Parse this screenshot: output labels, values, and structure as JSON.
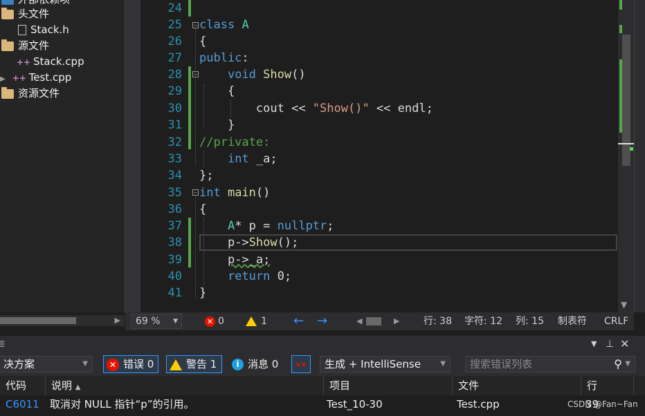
{
  "solution_explorer": {
    "items": [
      {
        "label": "外部依赖项",
        "icon": "external-deps-icon"
      },
      {
        "label": "头文件",
        "icon": "folder-icon"
      },
      {
        "label": "Stack.h",
        "icon": "header-file-icon"
      },
      {
        "label": "源文件",
        "icon": "folder-icon"
      },
      {
        "label": "Stack.cpp",
        "icon": "cpp-file-icon"
      },
      {
        "label": "Test.cpp",
        "icon": "cpp-file-icon"
      },
      {
        "label": "资源文件",
        "icon": "folder-icon"
      }
    ]
  },
  "editor": {
    "line_numbers": [
      "24",
      "25",
      "26",
      "27",
      "28",
      "29",
      "30",
      "31",
      "32",
      "33",
      "34",
      "35",
      "36",
      "37",
      "38",
      "39",
      "40",
      "41"
    ],
    "code": {
      "l25_kw": "class",
      "l25_name": "A",
      "l26": "{",
      "l27_kw": "public",
      "l27_colon": ":",
      "l28_kw": "void",
      "l28_fn": "Show",
      "l28_paren": "()",
      "l29": "{",
      "l30_cout": "cout",
      "l30_op1": " << ",
      "l30_str": "\"Show()\"",
      "l30_op2": " << ",
      "l30_endl": "endl",
      "l30_semi": ";",
      "l31": "}",
      "l32_comment": "//private:",
      "l33_kw": "int",
      "l33_var": " _a;",
      "l34": "};",
      "l35_kw": "int",
      "l35_fn": " main",
      "l35_paren": "()",
      "l36": "{",
      "l37_type": "A",
      "l37_rest": "* p = ",
      "l37_kw": "nullptr",
      "l37_semi": ";",
      "l38_var": "p->",
      "l38_fn": "Show",
      "l38_rest": "();",
      "l39": "p->_a;",
      "l40_kw": "return",
      "l40_rest": " 0;",
      "l41": "}"
    }
  },
  "status_bar": {
    "zoom": "69 %",
    "errors": "0",
    "warnings": "1",
    "line": "行: 38",
    "char": "字符: 12",
    "col": "列: 15",
    "tabs": "制表符",
    "eol": "CRLF"
  },
  "error_list": {
    "scope": "决方案",
    "errors_btn": "错误 0",
    "warnings_btn": "警告 1",
    "messages_btn": "消息 0",
    "build_filter": "生成 + IntelliSense",
    "search_placeholder": "搜索错误列表",
    "columns": {
      "code": "代码",
      "desc": "说明",
      "project": "项目",
      "file": "文件",
      "line": "行"
    },
    "row": {
      "code": "C6011",
      "desc": "取消对 NULL 指针“p”的引用。",
      "project": "Test_10-30",
      "file": "Test.cpp",
      "line": "39"
    }
  },
  "watermark": "CSDN @Fan~Fan",
  "colors": {
    "keyword": "#569cd6",
    "type": "#4ec9b0",
    "function": "#dcdcaa",
    "string": "#d69d85",
    "comment": "#57a64a",
    "line_number": "#2b91af"
  }
}
